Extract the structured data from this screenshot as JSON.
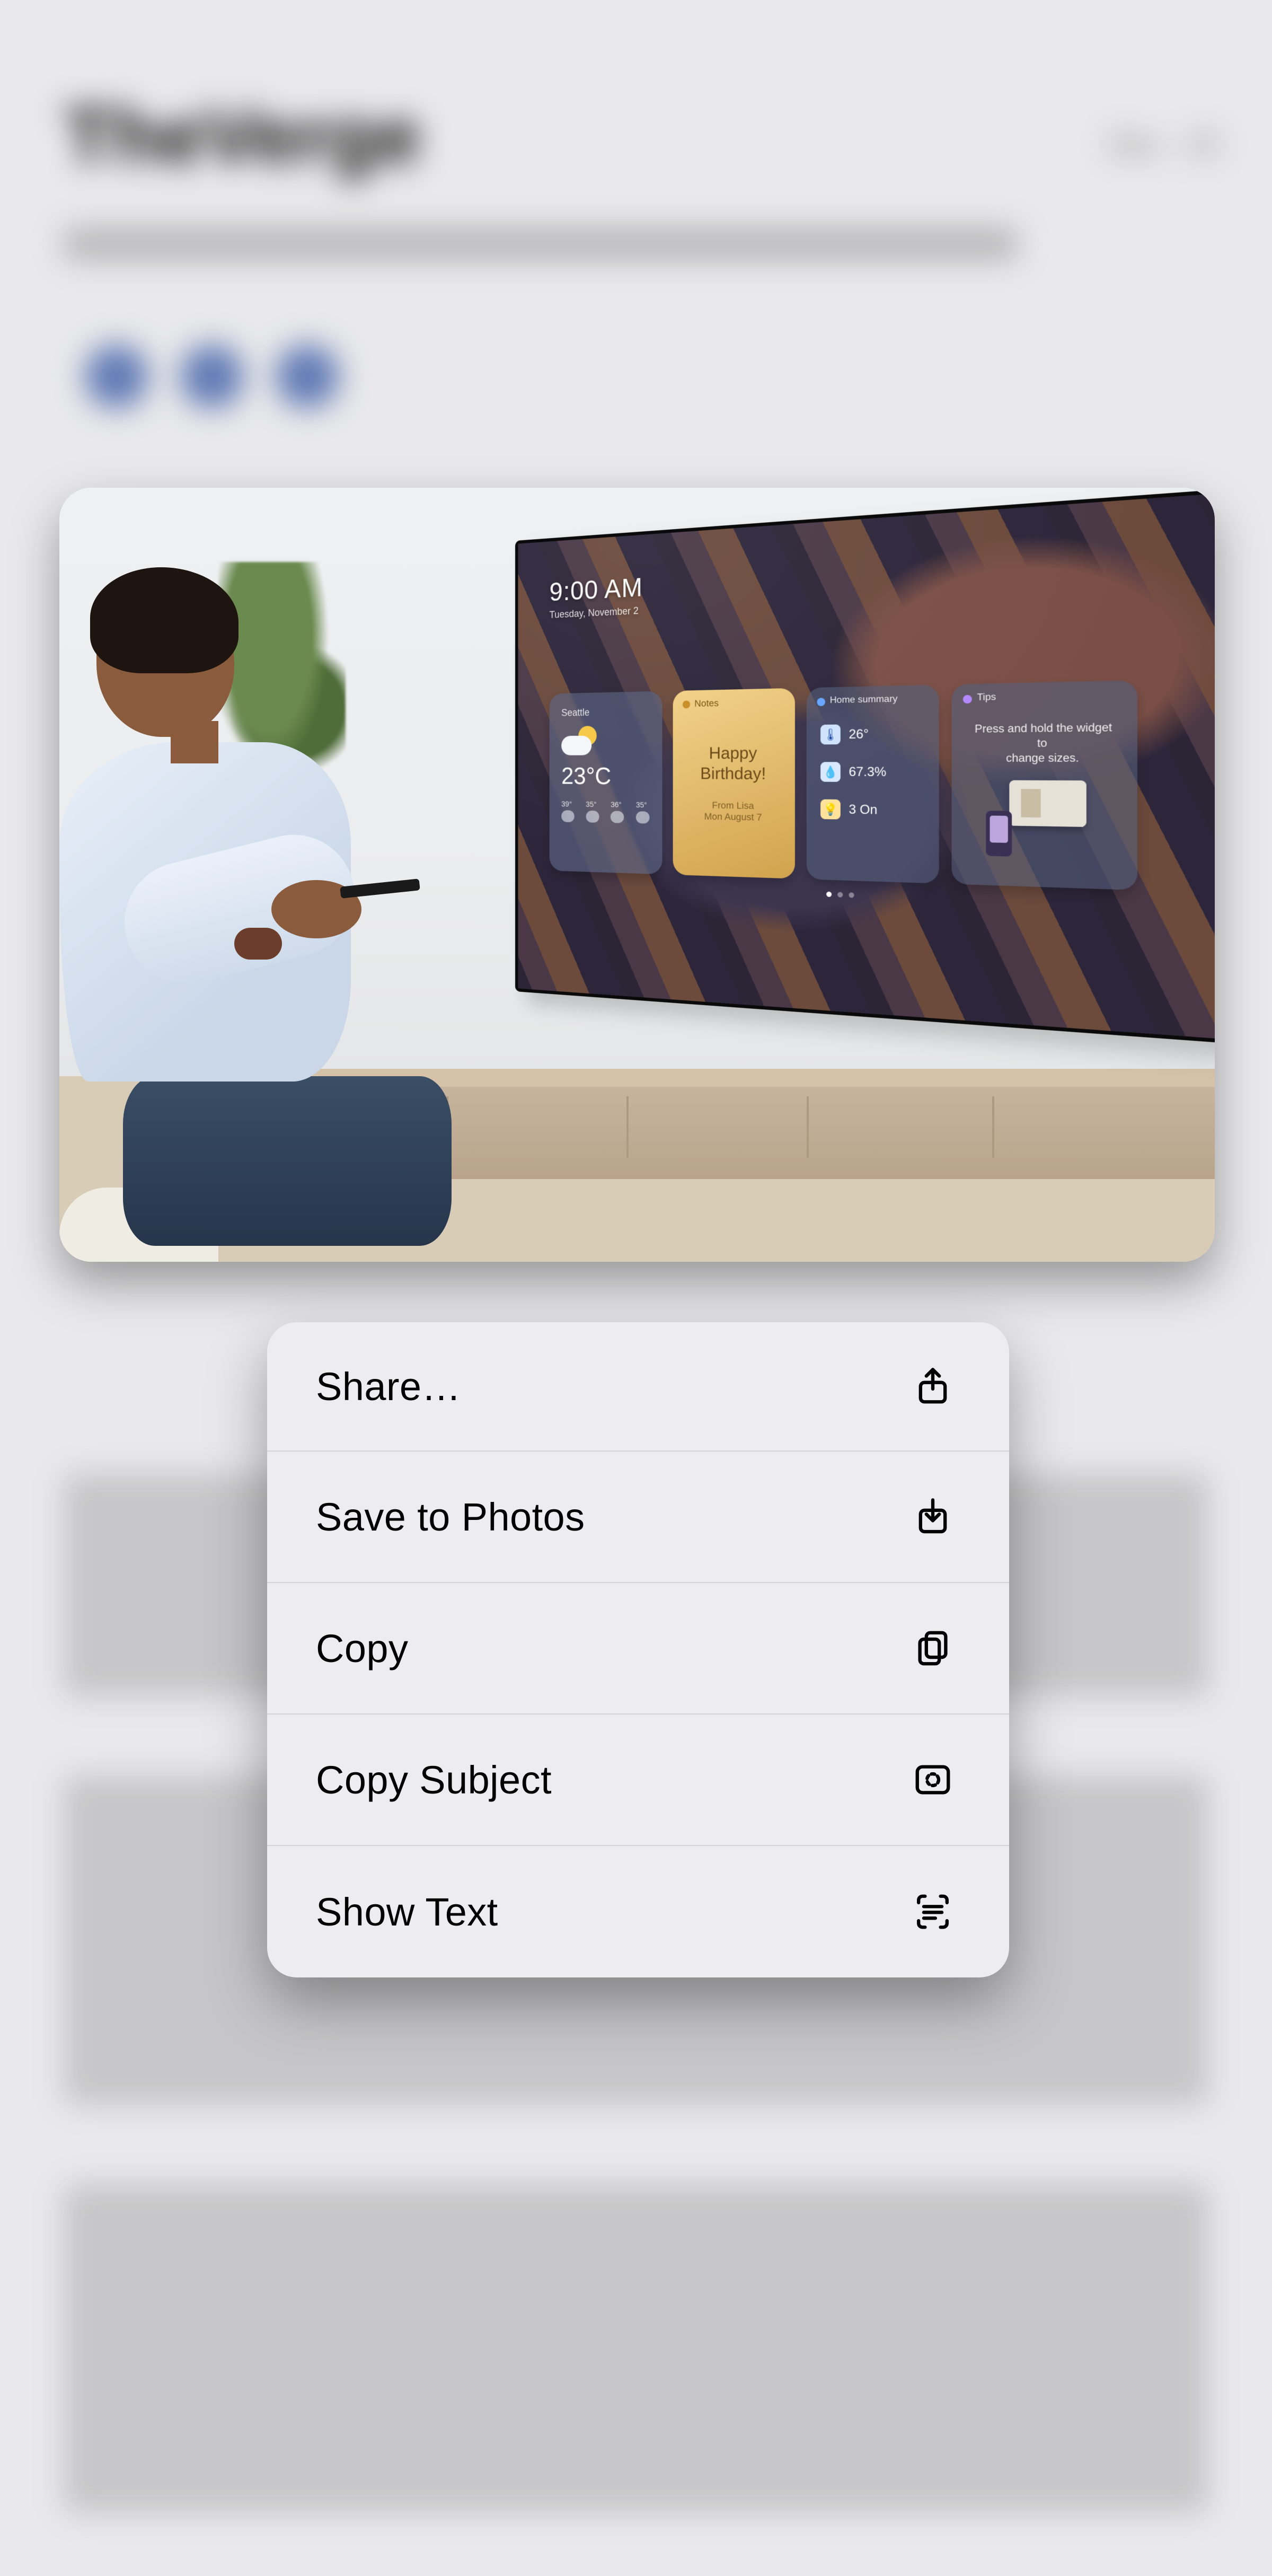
{
  "background": {
    "title": "TheVerge",
    "meta_right": "Dec · 23"
  },
  "tv": {
    "clock_time": "9:00 AM",
    "clock_date": "Tuesday, November 2",
    "weather": {
      "label": "Seattle",
      "temp": "23°C",
      "mini": [
        "39°",
        "35°",
        "36°",
        "35°"
      ]
    },
    "note": {
      "label": "Notes",
      "line1": "Happy",
      "line2": "Birthday!",
      "from": "From Lisa",
      "date": "Mon August 7"
    },
    "home": {
      "label": "Home summary",
      "rows": [
        {
          "icon": "🌡",
          "text": "26°"
        },
        {
          "icon": "💧",
          "text": "67.3%"
        },
        {
          "icon": "💡",
          "text": "3 On"
        }
      ]
    },
    "tips": {
      "label": "Tips",
      "tip_line1": "Press and hold the widget to",
      "tip_line2": "change sizes."
    }
  },
  "menu": {
    "items": [
      {
        "label": "Share…",
        "icon": "share-icon"
      },
      {
        "label": "Save to Photos",
        "icon": "save-down-icon"
      },
      {
        "label": "Copy",
        "icon": "copy-icon"
      },
      {
        "label": "Copy Subject",
        "icon": "select-subject-icon"
      },
      {
        "label": "Show Text",
        "icon": "live-text-icon"
      }
    ]
  }
}
